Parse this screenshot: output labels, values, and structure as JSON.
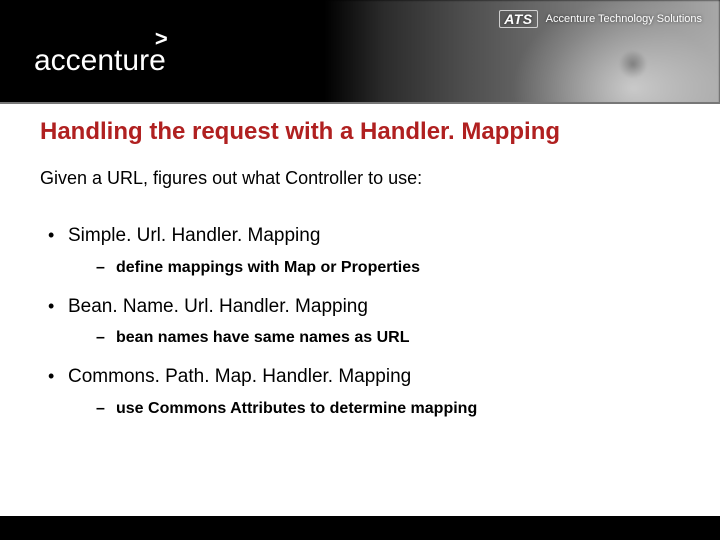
{
  "header": {
    "logo_wordmark": "accenture",
    "logo_chevron": ">",
    "ats_mark": "ATS",
    "ats_text": "Accenture Technology Solutions"
  },
  "slide": {
    "title": "Handling the request with a Handler. Mapping",
    "intro": "Given a URL, figures out what Controller to use:",
    "bullets": [
      {
        "text": "Simple. Url. Handler. Mapping",
        "sub": "define mappings with Map or Properties"
      },
      {
        "text": "Bean. Name. Url. Handler. Mapping",
        "sub": "bean names have same names as URL"
      },
      {
        "text": "Commons. Path. Map. Handler. Mapping",
        "sub": "use Commons Attributes to determine mapping"
      }
    ]
  }
}
